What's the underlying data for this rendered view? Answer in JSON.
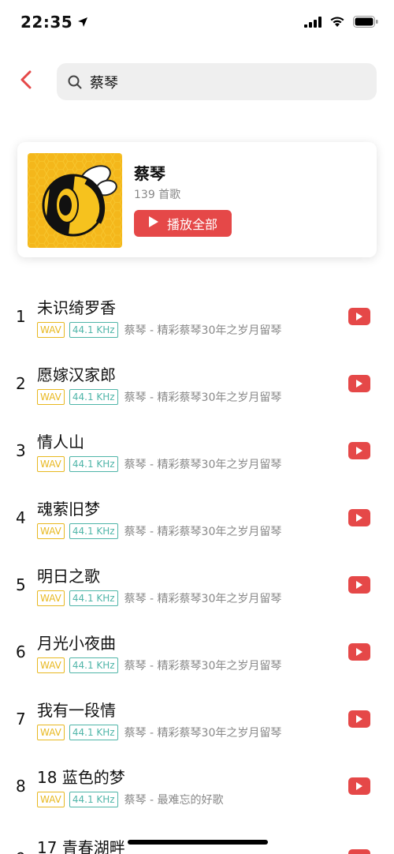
{
  "status_bar": {
    "time": "22:35"
  },
  "search": {
    "query": "蔡琴"
  },
  "artist": {
    "name": "蔡琴",
    "count": "139 首歌",
    "play_all_label": "播放全部"
  },
  "songs": [
    {
      "index": "1",
      "title": "未识绮罗香",
      "format": "WAV",
      "rate": "44.1 KHz",
      "subtitle": "蔡琴 - 精彩蔡琴30年之岁月留琴"
    },
    {
      "index": "2",
      "title": "愿嫁汉家郎",
      "format": "WAV",
      "rate": "44.1 KHz",
      "subtitle": "蔡琴 - 精彩蔡琴30年之岁月留琴"
    },
    {
      "index": "3",
      "title": "情人山",
      "format": "WAV",
      "rate": "44.1 KHz",
      "subtitle": "蔡琴 - 精彩蔡琴30年之岁月留琴"
    },
    {
      "index": "4",
      "title": "魂萦旧梦",
      "format": "WAV",
      "rate": "44.1 KHz",
      "subtitle": "蔡琴 - 精彩蔡琴30年之岁月留琴"
    },
    {
      "index": "5",
      "title": "明日之歌",
      "format": "WAV",
      "rate": "44.1 KHz",
      "subtitle": "蔡琴 - 精彩蔡琴30年之岁月留琴"
    },
    {
      "index": "6",
      "title": "月光小夜曲",
      "format": "WAV",
      "rate": "44.1 KHz",
      "subtitle": "蔡琴 - 精彩蔡琴30年之岁月留琴"
    },
    {
      "index": "7",
      "title": "我有一段情",
      "format": "WAV",
      "rate": "44.1 KHz",
      "subtitle": "蔡琴 - 精彩蔡琴30年之岁月留琴"
    },
    {
      "index": "8",
      "title": "18 蓝色的梦",
      "format": "WAV",
      "rate": "44.1 KHz",
      "subtitle": "蔡琴 - 最难忘的好歌"
    }
  ],
  "partial_song": {
    "index": "9",
    "title": "17 青春湖畔"
  },
  "colors": {
    "accent": "#e54848",
    "wav_tag": "#e8b820",
    "khz_tag": "#4fb5a8"
  }
}
